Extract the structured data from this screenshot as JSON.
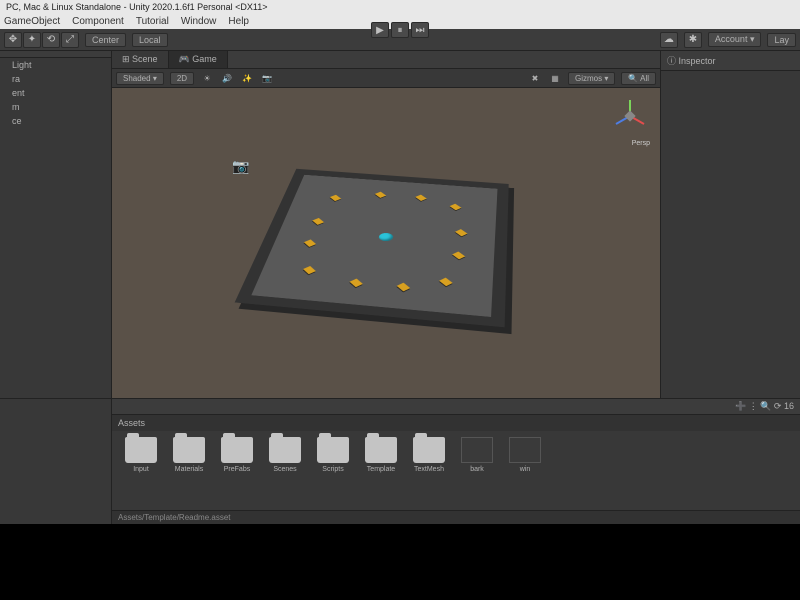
{
  "title": "PC, Mac & Linux Standalone - Unity 2020.1.6f1 Personal <DX11>",
  "menu": {
    "gameobject": "GameObject",
    "component": "Component",
    "tutorial": "Tutorial",
    "window": "Window",
    "help": "Help"
  },
  "toolbar": {
    "center": "Center",
    "local": "Local",
    "account": "Account",
    "layers": "Lay"
  },
  "hierarchy": {
    "items": [
      "Light",
      "ra",
      "ent",
      "m",
      "ce"
    ]
  },
  "tabs": {
    "scene": "Scene",
    "game": "Game"
  },
  "sceneToolbar": {
    "shaded": "Shaded",
    "twod": "2D",
    "gizmos": "Gizmos",
    "all": "All"
  },
  "viewport": {
    "persp": "Persp"
  },
  "inspector": {
    "title": "Inspector"
  },
  "project": {
    "assetsLabel": "Assets",
    "folders": [
      {
        "name": "Input",
        "type": "folder"
      },
      {
        "name": "Materials",
        "type": "folder"
      },
      {
        "name": "PreFabs",
        "type": "folder"
      },
      {
        "name": "Scenes",
        "type": "folder"
      },
      {
        "name": "Scripts",
        "type": "folder"
      },
      {
        "name": "Template",
        "type": "folder"
      },
      {
        "name": "TextMesh",
        "type": "folder"
      },
      {
        "name": "bark",
        "type": "file"
      },
      {
        "name": "win",
        "type": "file"
      }
    ],
    "status": "Assets/Template/Readme.asset",
    "autosave": "16"
  }
}
